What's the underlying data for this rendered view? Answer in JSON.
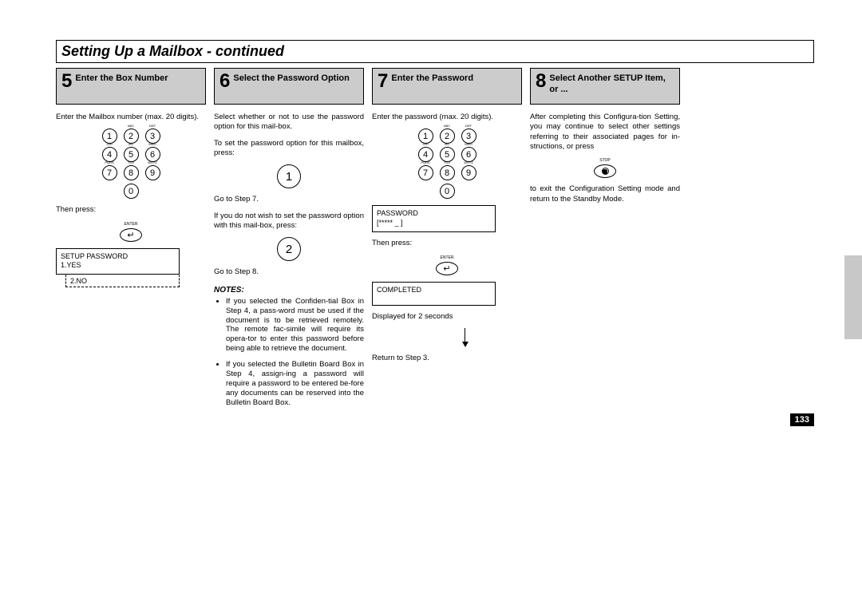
{
  "title": "Setting Up a Mailbox - continued",
  "page_number": "133",
  "steps": [
    {
      "num": "5",
      "title": "Enter the Box Number",
      "intro": "Enter the Mailbox number (max. 20 digits).",
      "then_press": "Then press:",
      "enter_label": "ENTER",
      "display_line1": "SETUP PASSWORD",
      "display_line2": "1.YES",
      "display_overflow": "2.NO"
    },
    {
      "num": "6",
      "title": "Select the Password Option",
      "p1": "Select whether or not to use the password option for this mail-box.",
      "p2": "To set the password option for this mailbox, press:",
      "goto7": "Go to Step 7.",
      "p3": "If you do not wish to set the password option with this mail-box, press:",
      "goto8": "Go to Step 8.",
      "notes_heading": "NOTES:",
      "note1": "If you selected the Confiden-tial Box in Step 4, a pass-word must be used if the document is to be retrieved remotely. The remote fac-simile will require its opera-tor to enter this password before being able to retrieve the document.",
      "note2": "If you selected the Bulletin Board Box in Step 4, assign-ing a password will require a password to be entered be-fore any documents can be reserved into the Bulletin Board Box."
    },
    {
      "num": "7",
      "title": "Enter the Password",
      "intro": "Enter the password (max. 20 digits).",
      "display_pw_label": "PASSWORD",
      "display_pw_value": "[*****    _         ]",
      "then_press": "Then press:",
      "enter_label": "ENTER",
      "display_completed": "COMPLETED",
      "displayed_for": "Displayed for 2 seconds",
      "return": "Return to Step 3."
    },
    {
      "num": "8",
      "title": "Select Another SETUP Item, or ...",
      "p1": "After completing this Configura-tion Setting, you may continue to select other settings referring to their associated pages for in-structions, or press",
      "stop_label": "STOP",
      "p2": "to exit the Configuration Setting mode and return to the Standby Mode."
    }
  ],
  "keypad_labels": {
    "2": "ABC",
    "3": "DEF",
    "4": "GHI",
    "5": "JKL",
    "6": "MNO",
    "7": "PQRS",
    "8": "TUV",
    "9": "WXYZ"
  }
}
